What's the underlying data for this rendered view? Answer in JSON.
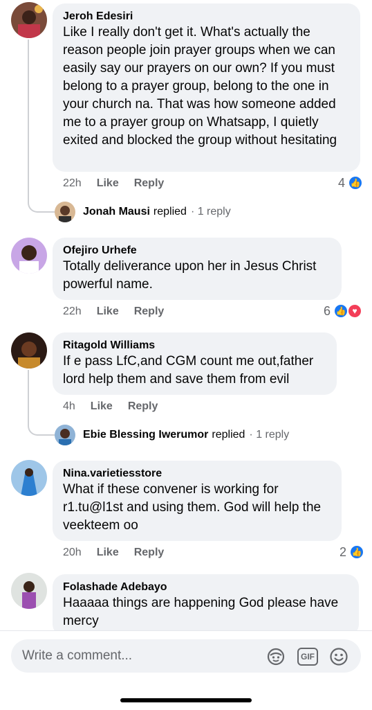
{
  "comments": [
    {
      "author": "Jeroh Edesiri",
      "text": "Like I really don't get it. What's actually the reason people join prayer groups when we can easily say our prayers on our own? If you must belong to a prayer group, belong to the one in your church na. That was how someone added me to a prayer group on Whatsapp, I quietly exited and blocked the group without hesitating",
      "time": "22h",
      "like": "Like",
      "reply": "Reply",
      "reactions": "4",
      "replies": {
        "name": "Jonah Mausi",
        "verb": "replied",
        "count": "· 1 reply"
      }
    },
    {
      "author": "Ofejiro Urhefe",
      "text": "Totally deliverance upon her in Jesus Christ powerful name.",
      "time": "22h",
      "like": "Like",
      "reply": "Reply",
      "reactions": "6"
    },
    {
      "author": "Ritagold Williams",
      "text": "If e pass LfC,and CGM count me out,father lord help them and save them from evil",
      "time": "4h",
      "like": "Like",
      "reply": "Reply",
      "replies": {
        "name": "Ebie Blessing Iwerumor",
        "verb": "replied",
        "count": "· 1 reply"
      }
    },
    {
      "author": "Nina.varietiesstore",
      "text": "What if these convener is working for r1.tu@l1st and using them. God will help the veekteem oo",
      "time": "20h",
      "like": "Like",
      "reply": "Reply",
      "reactions": "2"
    },
    {
      "author": "Folashade Adebayo",
      "text": "Haaaaa things are happening God please have mercy"
    }
  ],
  "composer": {
    "placeholder": "Write a comment...",
    "gif_label": "GIF"
  },
  "colors": {
    "accent": "#1877f2",
    "love": "#f33e58",
    "bubble": "#f0f2f5",
    "meta": "#65676b"
  }
}
